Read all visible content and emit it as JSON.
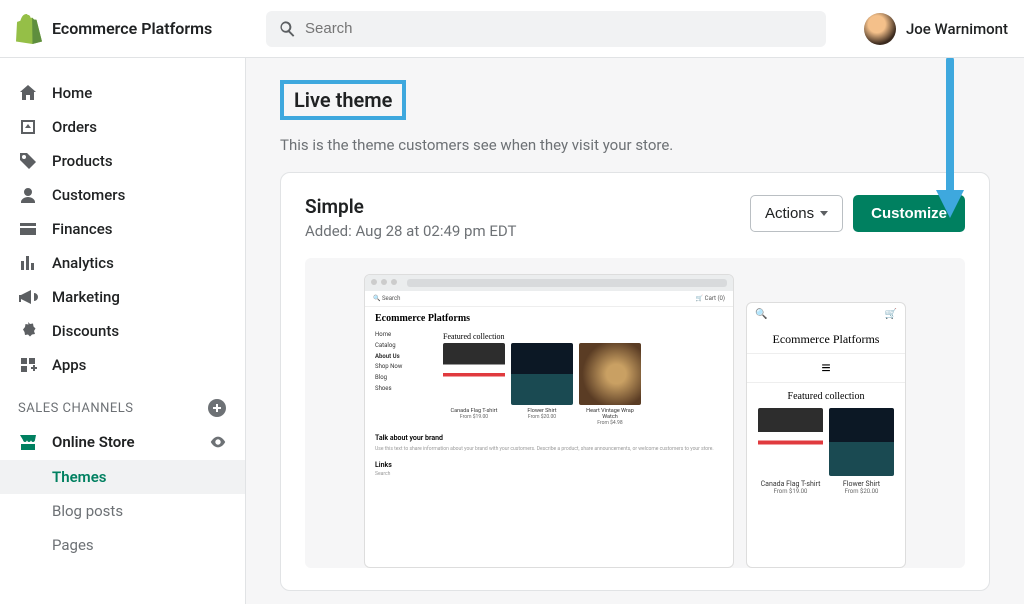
{
  "header": {
    "store_name": "Ecommerce Platforms",
    "search_placeholder": "Search",
    "user_name": "Joe Warnimont"
  },
  "sidebar": {
    "items": [
      {
        "label": "Home"
      },
      {
        "label": "Orders"
      },
      {
        "label": "Products"
      },
      {
        "label": "Customers"
      },
      {
        "label": "Finances"
      },
      {
        "label": "Analytics"
      },
      {
        "label": "Marketing"
      },
      {
        "label": "Discounts"
      },
      {
        "label": "Apps"
      }
    ],
    "channels_label": "SALES CHANNELS",
    "online_store": "Online Store",
    "subnav": [
      {
        "label": "Themes"
      },
      {
        "label": "Blog posts"
      },
      {
        "label": "Pages"
      }
    ]
  },
  "main": {
    "heading": "Live theme",
    "subtitle": "This is the theme customers see when they visit your store.",
    "theme_name": "Simple",
    "theme_meta": "Added: Aug 28 at 02:49 pm EDT",
    "actions_label": "Actions",
    "customize_label": "Customize"
  },
  "preview": {
    "site_title": "Ecommerce Platforms",
    "search_label": "Search",
    "cart_label": "Cart (0)",
    "nav_items": [
      "Home",
      "Catalog",
      "About Us",
      "Shop Now",
      "Blog",
      "Shoes"
    ],
    "featured_label": "Featured collection",
    "products": [
      {
        "name": "Canada Flag T-shirt",
        "price": "From $19.00"
      },
      {
        "name": "Flower Shirt",
        "price": "From $20.00"
      },
      {
        "name": "Heart Vintage Wrap Watch",
        "price": "From $4.98"
      }
    ],
    "talk_heading": "Talk about your brand",
    "talk_text": "Use this text to share information about your brand with your customers. Describe a product, share announcements, or welcome customers to your store.",
    "links_heading": "Links",
    "links_text": "Search",
    "mobile": {
      "products": [
        {
          "name": "Canada Flag T-shirt",
          "price": "From $19.00"
        },
        {
          "name": "Flower Shirt",
          "price": "From $20.00"
        }
      ]
    }
  }
}
